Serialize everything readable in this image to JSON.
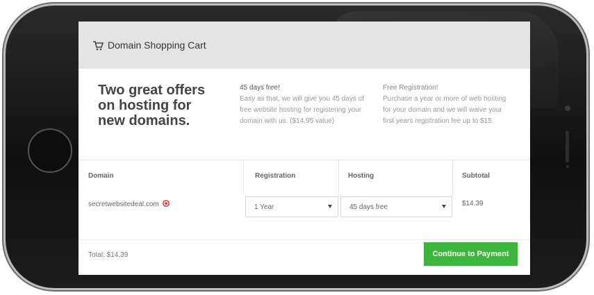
{
  "header": {
    "title": "Domain Shopping Cart",
    "icon": "shopping-cart-icon"
  },
  "offers": {
    "headline": "Two great offers on hosting for new domains.",
    "offer1": {
      "title": "45 days free!",
      "text": "Easy as that, we will give you 45 days of free website hosting for registering your domain with us. ($14.95 value)"
    },
    "offer2": {
      "title": "Free Registration!",
      "text": "Purchase a year or more of web hosting for your domain and we will waive your first years registration fee up to $15."
    }
  },
  "table": {
    "columns": [
      "Domain",
      "Registration",
      "Hosting",
      "Subtotal"
    ],
    "rows": [
      {
        "domain": "secretwebsitedeal.com",
        "registration": "1 Year",
        "hosting": "45 days free",
        "subtotal": "$14.39"
      }
    ]
  },
  "footer": {
    "total": "Total: $14.39",
    "button": "Continue to Payment"
  },
  "colors": {
    "accent_green": "#3cb73c",
    "remove_red": "#e02424",
    "header_bg": "#e4e4e4"
  }
}
